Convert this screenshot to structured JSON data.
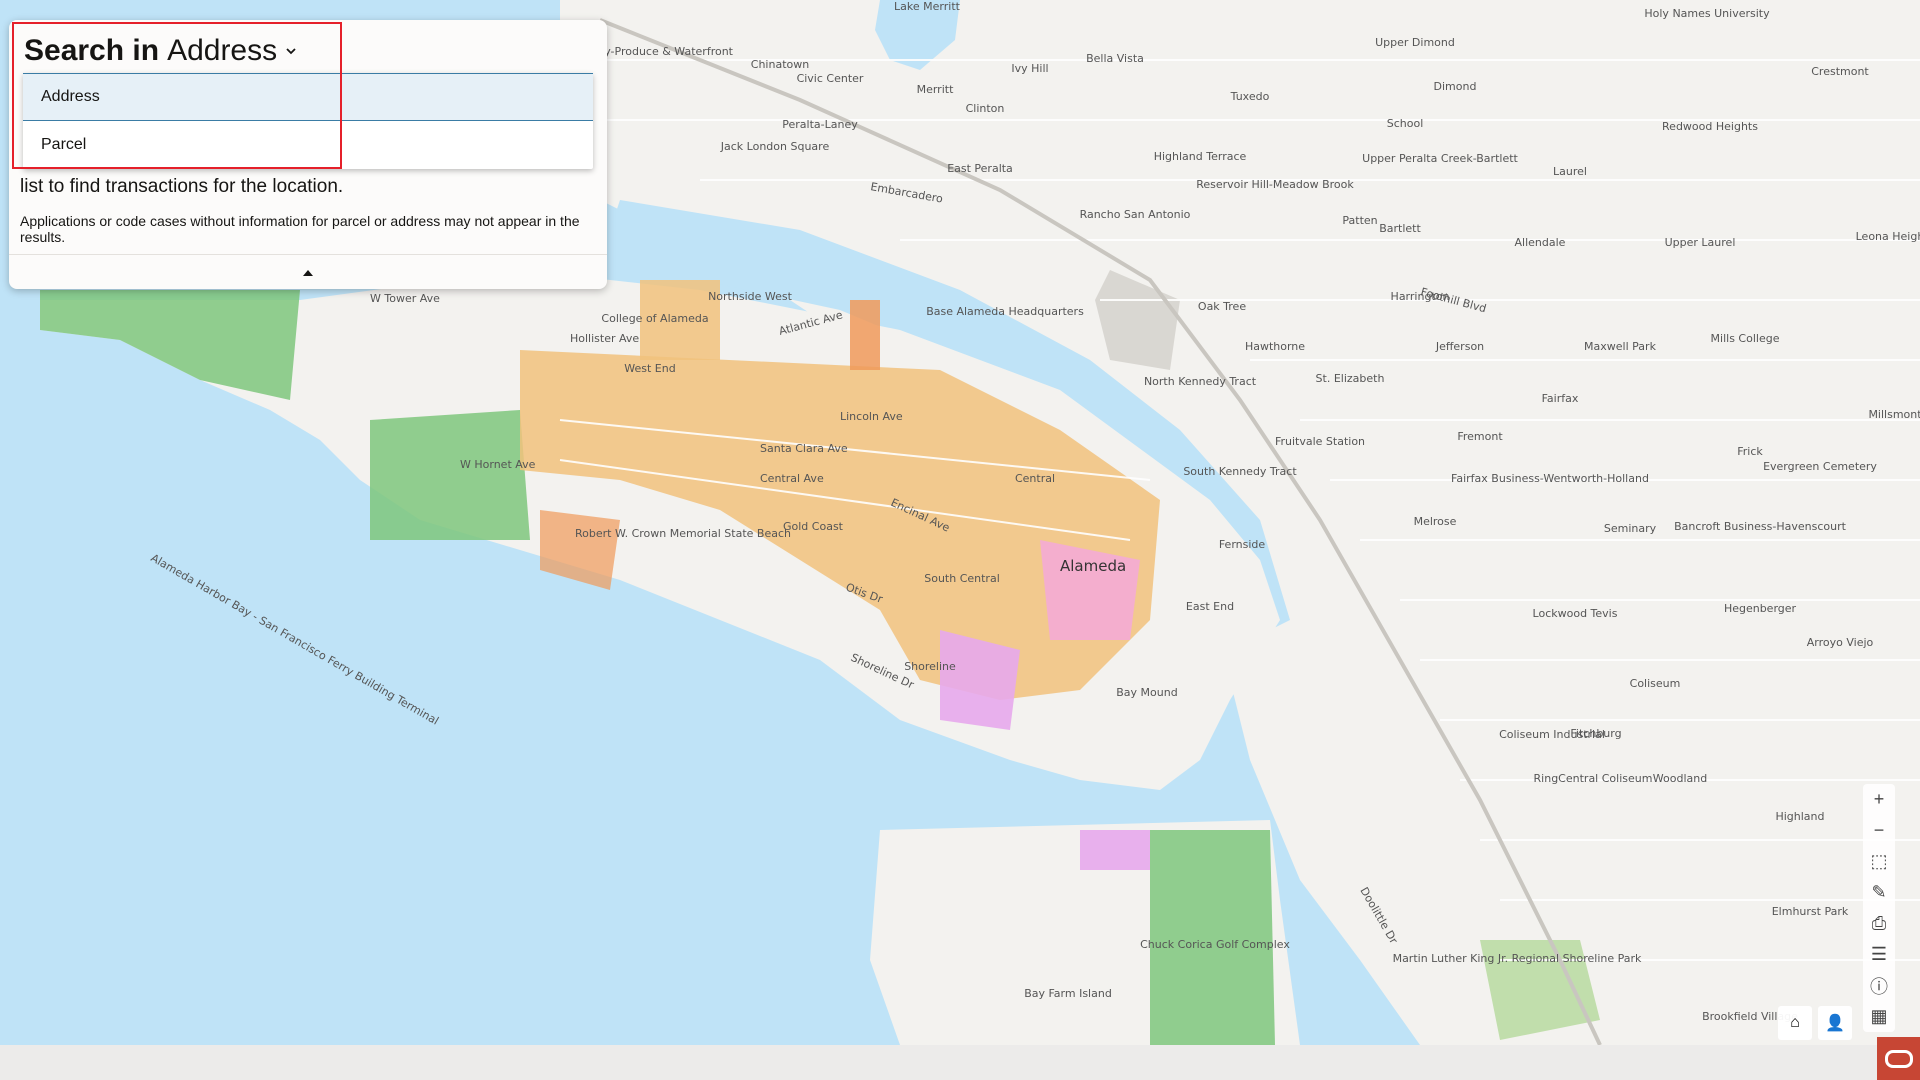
{
  "search": {
    "title_prefix": "Search in",
    "title_mode": "Address",
    "description_line2": "list to find transactions for the location.",
    "note": "Applications or code cases without information for parcel or address may not appear in the results."
  },
  "dropdown": {
    "options": [
      "Address",
      "Parcel"
    ],
    "selected": "Address"
  },
  "map": {
    "city_label": "Alameda",
    "labels": [
      "Chinatown",
      "Old City-Produce & Waterfront",
      "Civic Center",
      "Merritt",
      "Ivy Hill",
      "Bella Vista",
      "Upper Dimond",
      "Dimond",
      "Tuxedo",
      "Peralta-Laney",
      "Clinton",
      "Jack London Square",
      "East Peralta",
      "Highland Terrace",
      "Reservoir Hill-Meadow Brook",
      "School",
      "Upper Peralta Creek-Bartlett",
      "Laurel",
      "Redwood Heights",
      "Crestmont",
      "Patten",
      "Bartlett",
      "Allendale",
      "Rancho San Antonio",
      "Oak Tree",
      "Harrington",
      "Upper Laurel",
      "Leona Heights",
      "Base Alameda Headquarters",
      "Northside West",
      "College of Alameda",
      "West End",
      "Hawthorne",
      "Jefferson",
      "Maxwell Park",
      "Mills College",
      "North Kennedy Tract",
      "St. Elizabeth",
      "Fairfax",
      "Millsmont",
      "Fruitvale Station",
      "Fremont",
      "Frick",
      "Evergreen Cemetery",
      "South Kennedy Tract",
      "Fairfax Business-Wentworth-Holland",
      "Melrose",
      "Seminary",
      "Bancroft Business-Havenscourt",
      "Gold Coast",
      "Central",
      "Robert W. Crown Memorial State Beach",
      "Fernside",
      "South Central",
      "East End",
      "Lockwood Tevis",
      "Hegenberger",
      "Arroyo Viejo",
      "Coliseum",
      "Shoreline",
      "Bay Mound",
      "Fitchburg",
      "Coliseum Industrial",
      "RingCentral Coliseum",
      "Woodland",
      "Highland",
      "Elmhurst Park",
      "Chuck Corica Golf Complex",
      "Martin Luther King Jr. Regional Shoreline Park",
      "Bay Farm Island",
      "Brookfield Village",
      "Holy Names University",
      "Lake Merritt"
    ],
    "street_labels": [
      "Alameda Harbor Bay - San Francisco Ferry Building Terminal",
      "Lincoln Ave",
      "Central Ave",
      "Santa Clara Ave",
      "Encinal Ave",
      "Shoreline Dr",
      "Otis Dr",
      "Atlantic Ave",
      "W Tower Ave",
      "Hollister Ave",
      "W Hornet Ave",
      "Embarcadero",
      "Foothill Blvd",
      "Doolittle Dr"
    ]
  },
  "toolbar": {
    "icons": [
      "zoom-in-icon",
      "zoom-out-icon",
      "select-area-icon",
      "draw-icon",
      "print-icon",
      "legend-icon",
      "info-icon",
      "qr-icon"
    ]
  },
  "colors": {
    "water": "#bfe3f7",
    "land": "#f3f2ef",
    "park": "#7ec77c",
    "zoning_orange": "#f1c27d",
    "zoning_pink": "#f4a9d9",
    "highlight": "#e5202a",
    "oracle": "#c74634"
  }
}
